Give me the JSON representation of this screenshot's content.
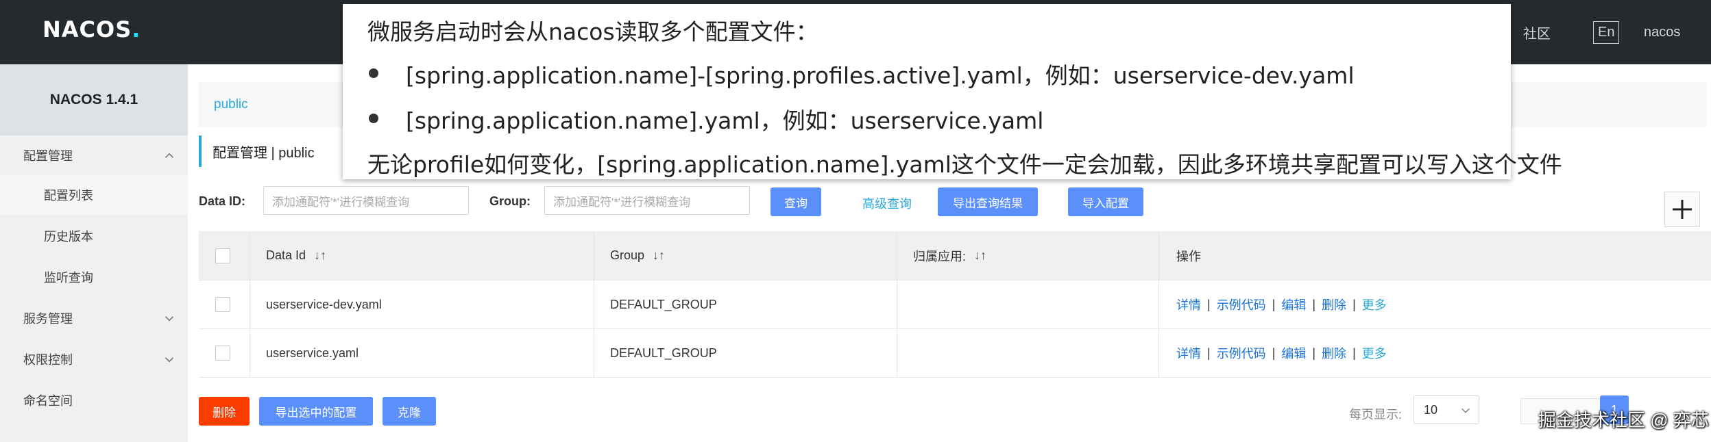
{
  "header": {
    "logo_main": "NACOS",
    "logo_dot": ".",
    "community": "社区",
    "lang": "En",
    "user": "nacos"
  },
  "sidebar": {
    "version": "NACOS 1.4.1",
    "items": [
      {
        "label": "配置管理",
        "expanded": true
      },
      {
        "label": "配置列表"
      },
      {
        "label": "历史版本"
      },
      {
        "label": "监听查询"
      },
      {
        "label": "服务管理"
      },
      {
        "label": "权限控制"
      },
      {
        "label": "命名空间"
      }
    ]
  },
  "main": {
    "namespace": "public",
    "breadcrumb": "配置管理 | public",
    "filters": {
      "data_id_label": "Data ID:",
      "data_id_placeholder": "添加通配符'*'进行模糊查询",
      "group_label": "Group:",
      "group_placeholder": "添加通配符'*'进行模糊查询",
      "query_button": "查询",
      "advanced_query": "高级查询",
      "export_results_button": "导出查询结果",
      "import_button": "导入配置"
    },
    "table": {
      "headers": [
        "Data Id",
        "Group",
        "归属应用:",
        "操作"
      ],
      "sort_glyph": "↓↑",
      "rows": [
        {
          "data_id": "userservice-dev.yaml",
          "group": "DEFAULT_GROUP",
          "app": ""
        },
        {
          "data_id": "userservice.yaml",
          "group": "DEFAULT_GROUP",
          "app": ""
        }
      ],
      "operations": {
        "detail": "详情",
        "sample_code": "示例代码",
        "edit": "编辑",
        "delete": "删除",
        "more": "更多",
        "separator": "|"
      }
    },
    "bottom": {
      "delete_button": "删除",
      "export_selected_button": "导出选中的配置",
      "clone_button": "克隆",
      "page_size_label": "每页显示:",
      "page_size": "10",
      "current_page": "1"
    }
  },
  "note": {
    "line1": "微服务启动时会从nacos读取多个配置文件：",
    "bullet1": "[spring.application.name]-[spring.profiles.active].yaml，例如：userservice-dev.yaml",
    "bullet2": "[spring.application.name].yaml，例如：userservice.yaml",
    "line4": "无论profile如何变化，[spring.application.name].yaml这个文件一定会加载，因此多环境共享配置可以写入这个文件"
  },
  "watermark": "掘金技术社区 @ 弈芯",
  "colors": {
    "topbar": "#252a2f",
    "accent": "#29a9d8",
    "primary_button": "#5b8ff9",
    "danger_button": "#fa3c00",
    "link": "#1a73d9"
  }
}
